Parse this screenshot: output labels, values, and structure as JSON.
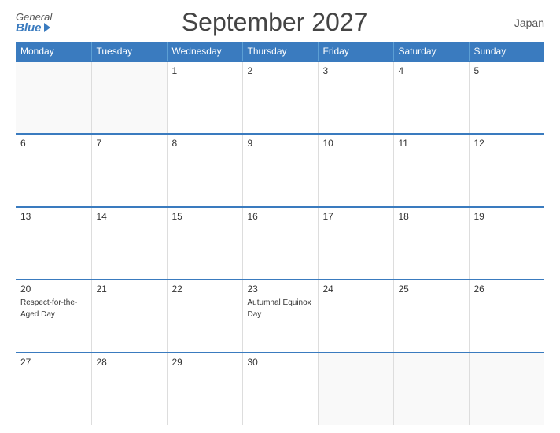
{
  "header": {
    "logo_general": "General",
    "logo_blue": "Blue",
    "title": "September 2027",
    "country": "Japan"
  },
  "weekdays": [
    "Monday",
    "Tuesday",
    "Wednesday",
    "Thursday",
    "Friday",
    "Saturday",
    "Sunday"
  ],
  "weeks": [
    [
      {
        "day": "",
        "empty": true
      },
      {
        "day": "",
        "empty": true
      },
      {
        "day": "1",
        "empty": false,
        "event": ""
      },
      {
        "day": "2",
        "empty": false,
        "event": ""
      },
      {
        "day": "3",
        "empty": false,
        "event": ""
      },
      {
        "day": "4",
        "empty": false,
        "event": ""
      },
      {
        "day": "5",
        "empty": false,
        "event": ""
      }
    ],
    [
      {
        "day": "6",
        "empty": false,
        "event": ""
      },
      {
        "day": "7",
        "empty": false,
        "event": ""
      },
      {
        "day": "8",
        "empty": false,
        "event": ""
      },
      {
        "day": "9",
        "empty": false,
        "event": ""
      },
      {
        "day": "10",
        "empty": false,
        "event": ""
      },
      {
        "day": "11",
        "empty": false,
        "event": ""
      },
      {
        "day": "12",
        "empty": false,
        "event": ""
      }
    ],
    [
      {
        "day": "13",
        "empty": false,
        "event": ""
      },
      {
        "day": "14",
        "empty": false,
        "event": ""
      },
      {
        "day": "15",
        "empty": false,
        "event": ""
      },
      {
        "day": "16",
        "empty": false,
        "event": ""
      },
      {
        "day": "17",
        "empty": false,
        "event": ""
      },
      {
        "day": "18",
        "empty": false,
        "event": ""
      },
      {
        "day": "19",
        "empty": false,
        "event": ""
      }
    ],
    [
      {
        "day": "20",
        "empty": false,
        "event": "Respect-for-the-Aged Day"
      },
      {
        "day": "21",
        "empty": false,
        "event": ""
      },
      {
        "day": "22",
        "empty": false,
        "event": ""
      },
      {
        "day": "23",
        "empty": false,
        "event": "Autumnal Equinox Day"
      },
      {
        "day": "24",
        "empty": false,
        "event": ""
      },
      {
        "day": "25",
        "empty": false,
        "event": ""
      },
      {
        "day": "26",
        "empty": false,
        "event": ""
      }
    ],
    [
      {
        "day": "27",
        "empty": false,
        "event": ""
      },
      {
        "day": "28",
        "empty": false,
        "event": ""
      },
      {
        "day": "29",
        "empty": false,
        "event": ""
      },
      {
        "day": "30",
        "empty": false,
        "event": ""
      },
      {
        "day": "",
        "empty": true
      },
      {
        "day": "",
        "empty": true
      },
      {
        "day": "",
        "empty": true
      }
    ]
  ]
}
